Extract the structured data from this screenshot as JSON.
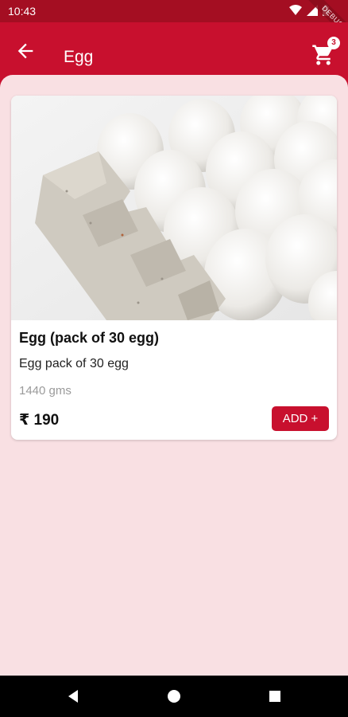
{
  "status_bar": {
    "time": "10:43",
    "debug_label": "DEBUG"
  },
  "app_bar": {
    "title": "Egg",
    "cart_count": "3"
  },
  "product": {
    "name": "Egg (pack of 30 egg)",
    "description": "Egg pack of 30 egg",
    "weight": "1440 gms",
    "price": "₹ 190",
    "add_label": "ADD +"
  },
  "colors": {
    "primary": "#c8102e",
    "status_bar": "#a40e22",
    "background": "#f9e0e3"
  },
  "icons": {
    "back": "arrow-back-icon",
    "cart": "cart-icon",
    "wifi": "wifi-icon",
    "signal": "signal-icon",
    "battery": "battery-icon"
  }
}
